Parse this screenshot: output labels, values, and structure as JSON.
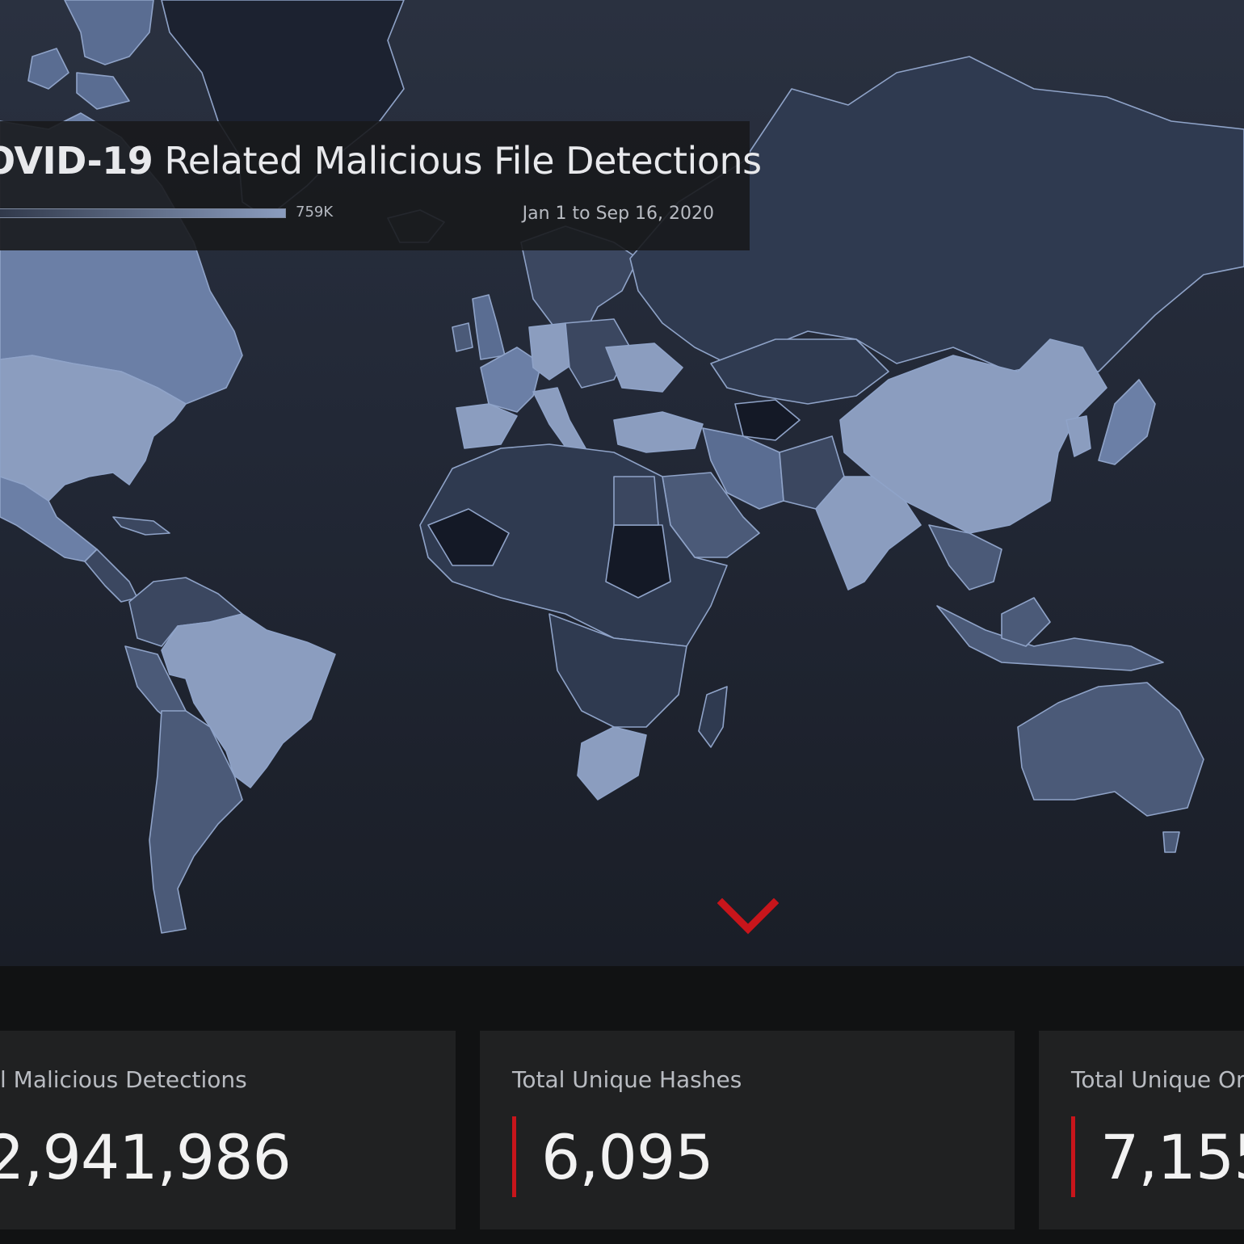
{
  "header": {
    "title_bold": "OVID-19",
    "title_rest": " Related Malicious File Detections",
    "legend_max": "759K",
    "date_range": "Jan 1 to Sep 16, 2020"
  },
  "map": {
    "highlighted_country": "Brazil",
    "colors": {
      "ocean": "#222836",
      "low": "#1a2030",
      "mid": "#3b4760",
      "high": "#8b9dbf",
      "border": "#8fa3c8",
      "selected_border": "#ffffff"
    }
  },
  "scroll_indicator": {
    "icon": "chevron-down-icon",
    "color": "#c8151b"
  },
  "stats": [
    {
      "label": "l Malicious Detections",
      "value": "2,941,986"
    },
    {
      "label": "Total Unique Hashes",
      "value": "6,095"
    },
    {
      "label": "Total Unique Org",
      "value": "7,155"
    }
  ]
}
